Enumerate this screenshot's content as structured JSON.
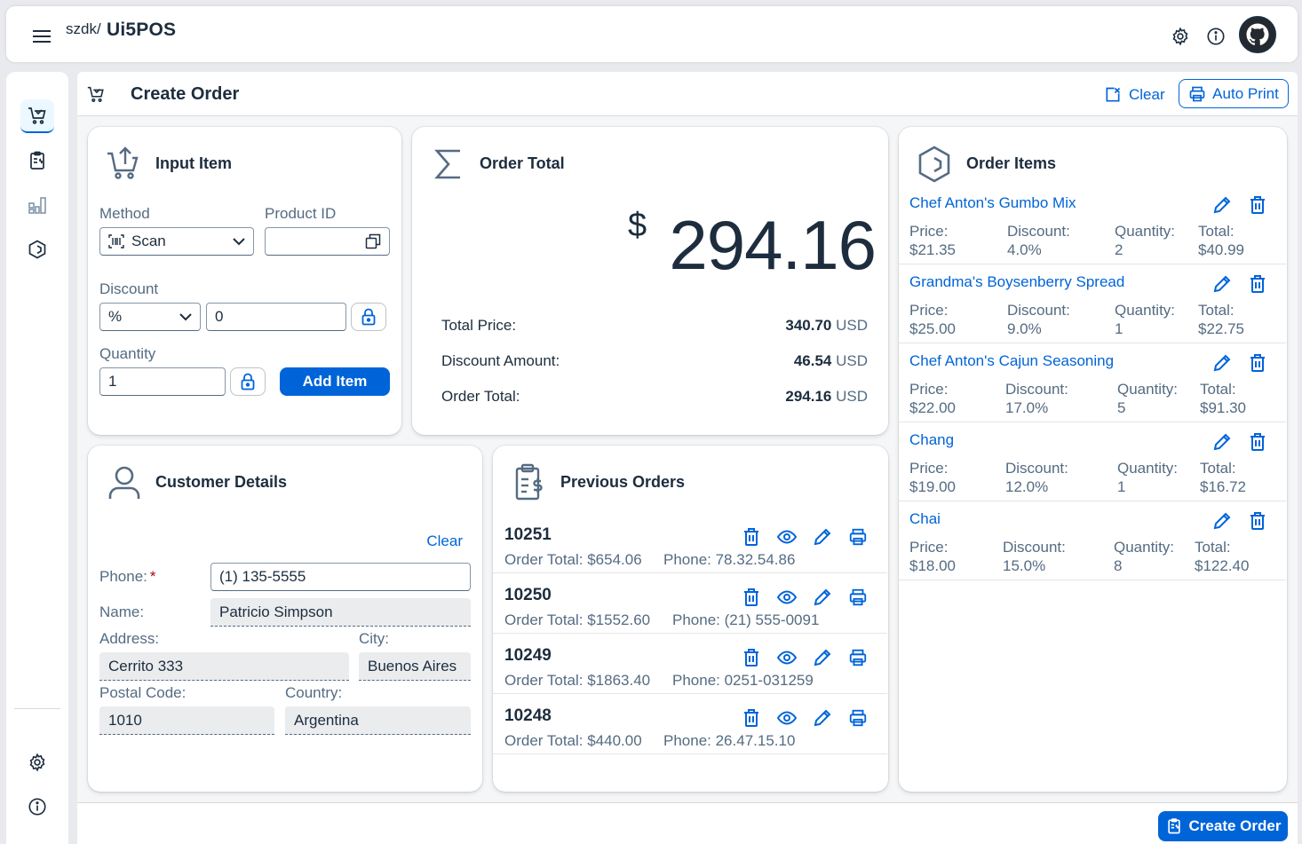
{
  "shell": {
    "brand_prefix": "szdk/",
    "brand_name": "Ui5POS"
  },
  "page": {
    "title": "Create Order",
    "clear_label": "Clear",
    "auto_print_label": "Auto Print",
    "create_order_label": "Create Order"
  },
  "input_item": {
    "title": "Input Item",
    "method_label": "Method",
    "method_value": "Scan",
    "product_id_label": "Product ID",
    "product_id_value": "",
    "discount_label": "Discount",
    "discount_type": "%",
    "discount_value": "0",
    "quantity_label": "Quantity",
    "quantity_value": "1",
    "add_item_label": "Add Item"
  },
  "order_total": {
    "title": "Order Total",
    "currency_symbol": "$",
    "amount": "294.16",
    "rows": [
      {
        "label": "Total Price:",
        "value": "340.70",
        "unit": "USD"
      },
      {
        "label": "Discount Amount:",
        "value": "46.54",
        "unit": "USD"
      },
      {
        "label": "Order Total:",
        "value": "294.16",
        "unit": "USD"
      }
    ]
  },
  "customer": {
    "title": "Customer Details",
    "clear_label": "Clear",
    "phone_label": "Phone:",
    "required_mark": "*",
    "phone_value": "(1) 135-5555",
    "name_label": "Name:",
    "name_value": "Patricio Simpson",
    "address_label": "Address:",
    "address_value": "Cerrito 333",
    "city_label": "City:",
    "city_value": "Buenos Aires",
    "postal_label": "Postal Code:",
    "postal_value": "1010",
    "country_label": "Country:",
    "country_value": "Argentina"
  },
  "previous_orders": {
    "title": "Previous Orders",
    "orders": [
      {
        "id": "10251",
        "total": "Order Total: $654.06",
        "phone": "Phone: 78.32.54.86"
      },
      {
        "id": "10250",
        "total": "Order Total: $1552.60",
        "phone": "Phone: (21) 555-0091"
      },
      {
        "id": "10249",
        "total": "Order Total: $1863.40",
        "phone": "Phone: 0251-031259"
      },
      {
        "id": "10248",
        "total": "Order Total: $440.00",
        "phone": "Phone: 26.47.15.10"
      }
    ]
  },
  "order_items": {
    "title": "Order Items",
    "labels": {
      "price": "Price:",
      "discount": "Discount:",
      "quantity": "Quantity:",
      "total": "Total:"
    },
    "items": [
      {
        "name": "Chef Anton's Gumbo Mix",
        "price": "$21.35",
        "discount": "4.0%",
        "quantity": "2",
        "total": "$40.99"
      },
      {
        "name": "Grandma's Boysenberry Spread",
        "price": "$25.00",
        "discount": "9.0%",
        "quantity": "1",
        "total": "$22.75"
      },
      {
        "name": "Chef Anton's Cajun Seasoning",
        "price": "$22.00",
        "discount": "17.0%",
        "quantity": "5",
        "total": "$91.30"
      },
      {
        "name": "Chang",
        "price": "$19.00",
        "discount": "12.0%",
        "quantity": "1",
        "total": "$16.72"
      },
      {
        "name": "Chai",
        "price": "$18.00",
        "discount": "15.0%",
        "quantity": "8",
        "total": "$122.40"
      }
    ]
  },
  "colors": {
    "accent": "#0064d9",
    "text": "#1d2d3e",
    "muted": "#556b82",
    "background": "#f5f6f7"
  },
  "icons": [
    "menu-icon",
    "settings-icon",
    "info-icon",
    "github-avatar-icon",
    "cart-icon",
    "orders-icon",
    "dashboard-icon",
    "product-icon",
    "clear-icon",
    "print-icon",
    "cart-upload-icon",
    "sigma-icon",
    "user-icon",
    "clipboard-dollar-icon",
    "delete-icon",
    "view-icon",
    "edit-icon",
    "barcode-icon",
    "dropdown-icon",
    "copy-icon",
    "lock-icon"
  ]
}
